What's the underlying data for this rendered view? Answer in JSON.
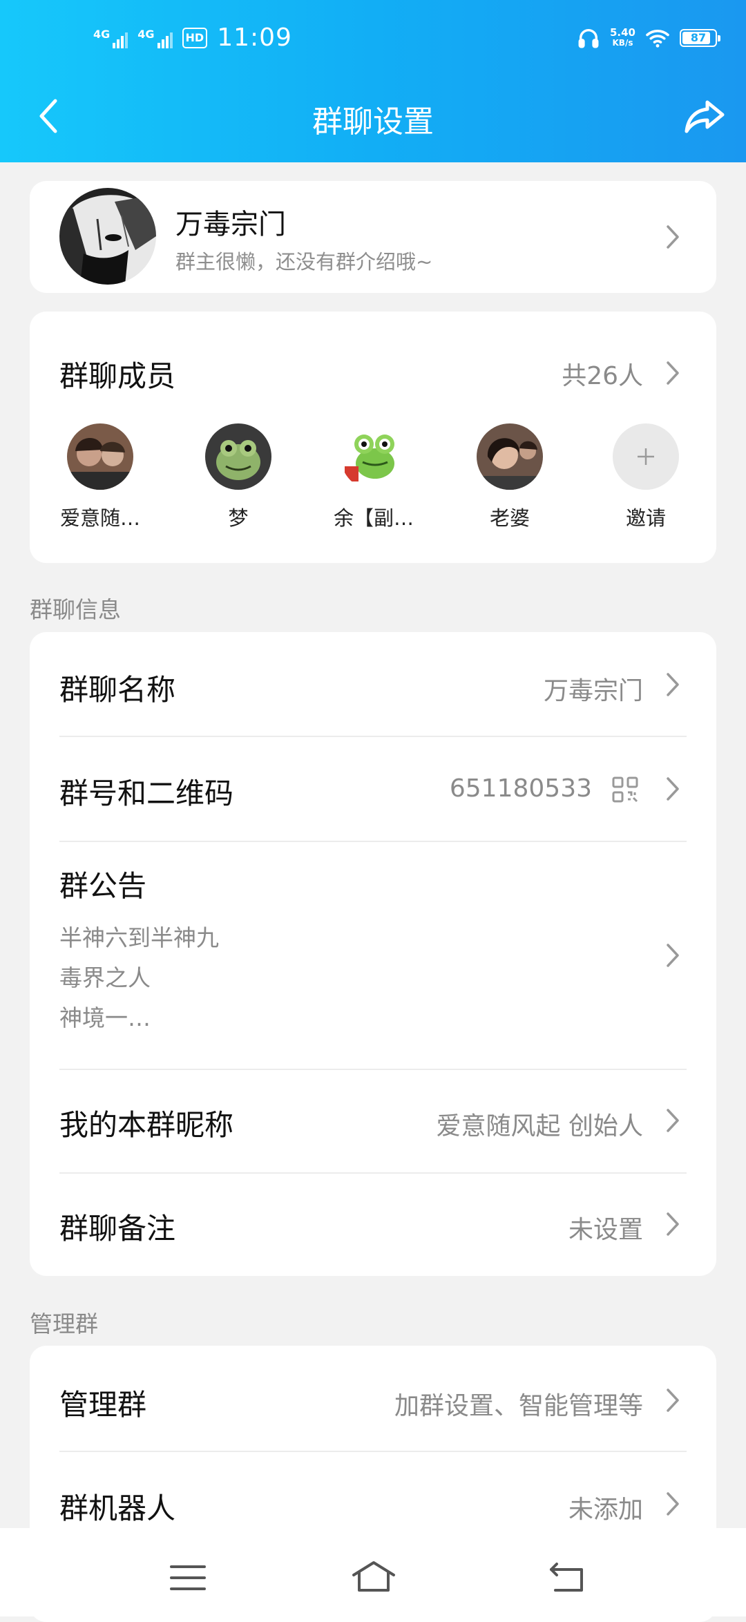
{
  "status_bar": {
    "signal1": "4G",
    "signal2": "4G",
    "hd": "HD",
    "time": "11:09",
    "speed_value": "5.40",
    "speed_unit": "KB/s",
    "battery": "87"
  },
  "nav": {
    "title": "群聊设置"
  },
  "group": {
    "name": "万毒宗门",
    "intro": "群主很懒，还没有群介绍哦~"
  },
  "members": {
    "title": "群聊成员",
    "count": "共26人",
    "list": [
      {
        "name": "爱意随…"
      },
      {
        "name": "梦"
      },
      {
        "name": "余【副…"
      },
      {
        "name": "老婆"
      },
      {
        "name": "邀请"
      }
    ]
  },
  "info_section": {
    "label": "群聊信息",
    "rows": [
      {
        "label": "群聊名称",
        "value": "万毒宗门"
      },
      {
        "label": "群号和二维码",
        "value": "651180533"
      },
      {
        "label": "群公告",
        "lines": [
          "半神六到半神九",
          "毒界之人",
          "神境一…"
        ]
      },
      {
        "label": "我的本群昵称",
        "value": "爱意随风起 创始人"
      },
      {
        "label": "群聊备注",
        "value": "未设置"
      }
    ]
  },
  "manage_section": {
    "label": "管理群",
    "rows": [
      {
        "label": "管理群",
        "value": "加群设置、智能管理等"
      },
      {
        "label": "群机器人",
        "value": "未添加"
      }
    ]
  },
  "colors": {
    "header_start": "#16c8fb",
    "header_end": "#1a98f0",
    "background": "#f2f2f2",
    "secondary_text": "#8a8a8a"
  },
  "icons": [
    "back-icon",
    "share-icon",
    "chevron-right-icon",
    "qr-code-icon",
    "plus-icon",
    "menu-icon",
    "home-icon",
    "return-icon",
    "headphones-icon",
    "wifi-icon",
    "battery-icon"
  ]
}
